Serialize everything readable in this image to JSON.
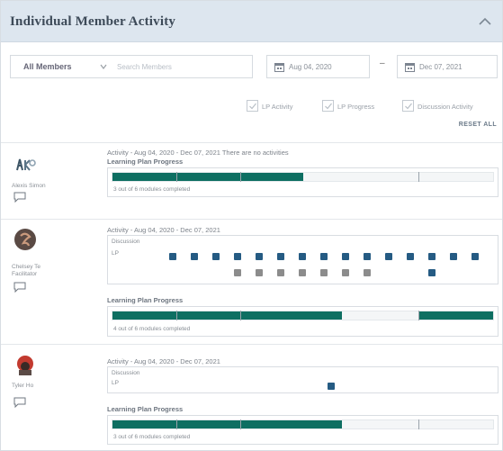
{
  "header": {
    "title": "Individual Member Activity"
  },
  "filters": {
    "member_select": "All Members",
    "search_placeholder": "Search Members",
    "start_date": "Aug 04, 2020",
    "dash": "–",
    "end_date": "Dec 07, 2021",
    "checkboxes": [
      {
        "label": "LP Activity",
        "checked": true
      },
      {
        "label": "LP Progress",
        "checked": true
      },
      {
        "label": "Discussion Activity",
        "checked": true
      }
    ],
    "reset_label": "RESET ALL"
  },
  "members": [
    {
      "name": "Alexis Simon",
      "activity_text": "Activity - Aug 04, 2020 - Dec 07, 2021 There are no activities",
      "progress_title": "Learning Plan Progress",
      "progress_text": "3 out of 6 modules completed",
      "modules_completed": 3,
      "modules_total": 6
    },
    {
      "name": "Chelsey Te Facilitator",
      "activity_text": "Activity - Aug 04, 2020 - Dec 07, 2021",
      "discussion_label": "Discussion",
      "lp_label": "LP",
      "progress_title": "Learning Plan Progress",
      "progress_text": "4 out of 6 modules completed",
      "modules_completed": 4,
      "modules_total": 6
    },
    {
      "name": "Tyler Ho",
      "activity_text": "Activity - Aug 04, 2020 - Dec 07, 2021",
      "discussion_label": "Discussion",
      "lp_label": "LP",
      "progress_title": "Learning Plan Progress",
      "progress_text": "3 out of 6 modules completed",
      "modules_completed": 3,
      "modules_total": 6
    }
  ],
  "colors": {
    "lp_activity": "#255b83",
    "discussion_activity": "#8c8c8c",
    "progress": "#0e6f62"
  },
  "icons": {
    "collapse": "chevron-up-icon",
    "calendar": "calendar-icon",
    "chat": "chat-bubble-icon"
  }
}
